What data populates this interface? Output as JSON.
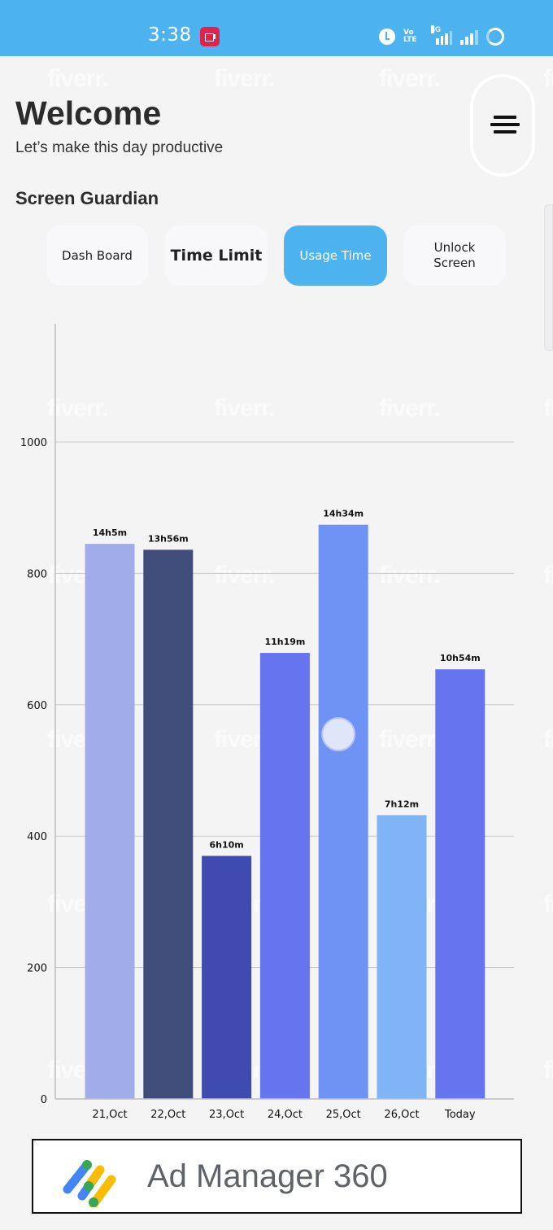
{
  "status_bar": {
    "time": "3:38",
    "network_label": "4G",
    "volte_label": "VoLTE",
    "icons": [
      "screen-record-icon",
      "alarm-icon",
      "volte-icon",
      "signal-4g-icon",
      "signal-icon",
      "battery-ring-icon"
    ]
  },
  "header": {
    "title": "Welcome",
    "subtitle": "Let’s make this day productive",
    "menu_icon": "menu-icon"
  },
  "section": {
    "title": "Screen Guardian"
  },
  "tabs": [
    {
      "label": "Dash Board",
      "active": false
    },
    {
      "label": "Time Limit",
      "active": false
    },
    {
      "label": "Usage Time",
      "active": true
    },
    {
      "label": "Unlock Screen",
      "active": false
    }
  ],
  "colors": {
    "accent": "#4cb3ee",
    "background": "#f4f4f5",
    "rec_badge": "#e0234e"
  },
  "chart_data": {
    "type": "bar",
    "title": "",
    "xlabel": "",
    "ylabel": "",
    "categories": [
      "21,Oct",
      "22,Oct",
      "23,Oct",
      "24,Oct",
      "25,Oct",
      "26,Oct",
      "Today"
    ],
    "values": [
      845,
      836,
      370,
      679,
      874,
      432,
      654
    ],
    "value_unit": "minutes",
    "data_labels": [
      "14h5m",
      "13h56m",
      "6h10m",
      "11h19m",
      "14h34m",
      "7h12m",
      "10h54m"
    ],
    "bar_colors": [
      "#a1ade8",
      "#404c7a",
      "#3f4bae",
      "#6574ef",
      "#6f92f5",
      "#7fb5f7",
      "#6574ef"
    ],
    "yticks": [
      0,
      200,
      400,
      600,
      800,
      1000
    ],
    "ylim": [
      0,
      1180
    ],
    "grid": true,
    "legend": "none",
    "touch_indicator_on": "25,Oct"
  },
  "ad": {
    "text": "Ad Manager 360"
  },
  "watermark": "fiverr."
}
